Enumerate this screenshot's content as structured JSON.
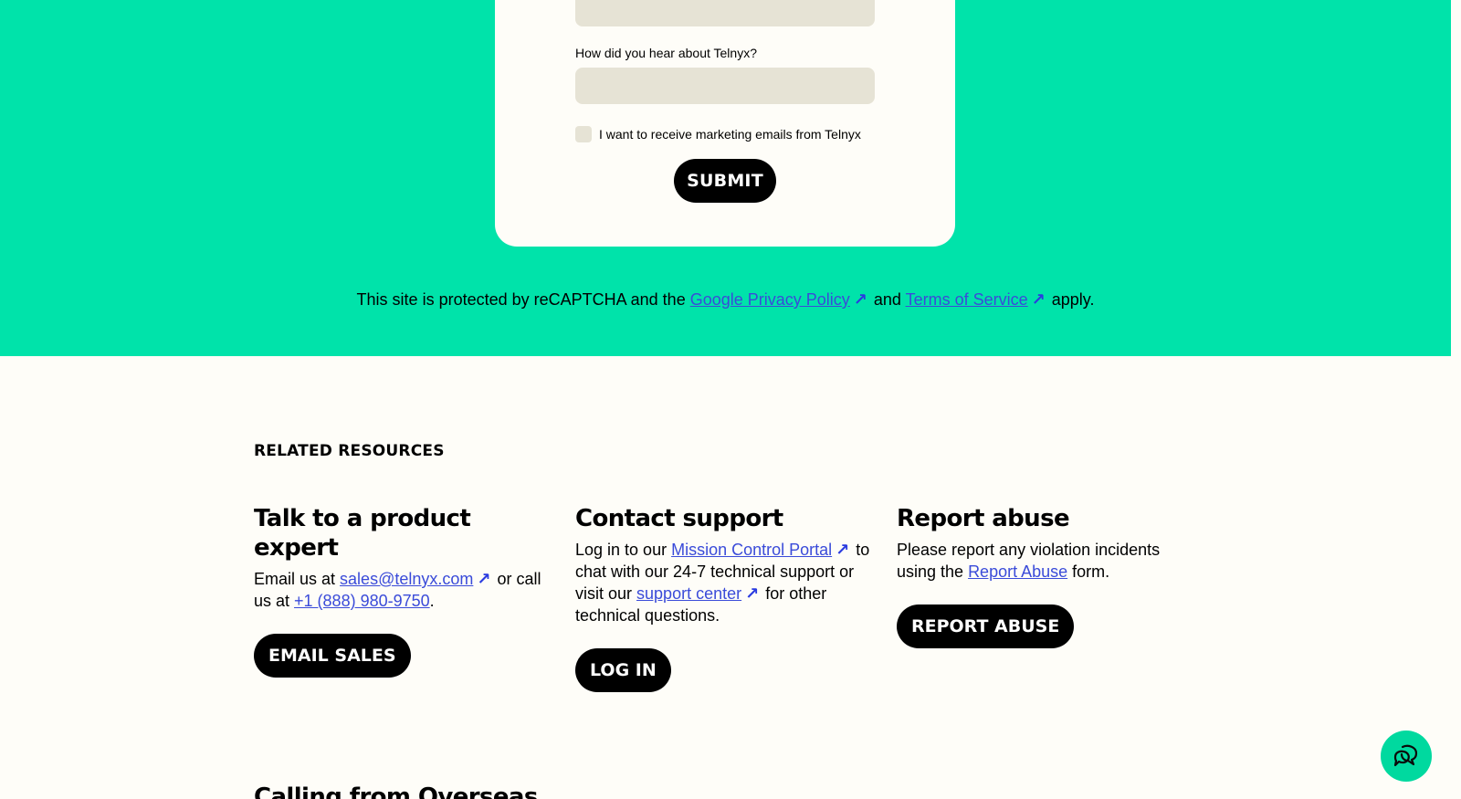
{
  "form": {
    "hear_label": "How did you hear about Telnyx?",
    "hear_value": "",
    "marketing_checkbox_label": "I want to receive marketing emails from Telnyx",
    "submit_label": "SUBMIT"
  },
  "recaptcha": {
    "prefix": "This site is protected by reCAPTCHA and the ",
    "privacy_link": "Google Privacy Policy",
    "and": " and ",
    "terms_link": "Terms of Service",
    "suffix": " apply."
  },
  "related": {
    "heading": "RELATED RESOURCES",
    "columns": [
      {
        "title": "Talk to a product expert",
        "text_1": "Email us at ",
        "link_1": "sales@telnyx.com",
        "text_2": " or call us at ",
        "link_2": "+1 (888) 980-9750",
        "text_3": ".",
        "button": "EMAIL SALES"
      },
      {
        "title": "Contact support",
        "text_1": "Log in to our ",
        "link_1": "Mission Control Portal",
        "text_2": " to chat with our 24-7 technical support or visit our ",
        "link_2": "support center",
        "text_3": " for other technical questions.",
        "button": "LOG IN"
      },
      {
        "title": "Report abuse",
        "text_1": "Please report any violation incidents using the ",
        "link_1": "Report Abuse",
        "text_2": " form.",
        "button": "REPORT ABUSE"
      }
    ]
  },
  "overseas_heading": "Calling from Overseas",
  "colors": {
    "brand_green": "#00e3aa",
    "background": "#fefdf8",
    "link": "#3a4bd9",
    "input": "#e6e3d5"
  },
  "icons": {
    "external_link": "north-east-arrow",
    "chat": "chat-bubbles-icon"
  }
}
